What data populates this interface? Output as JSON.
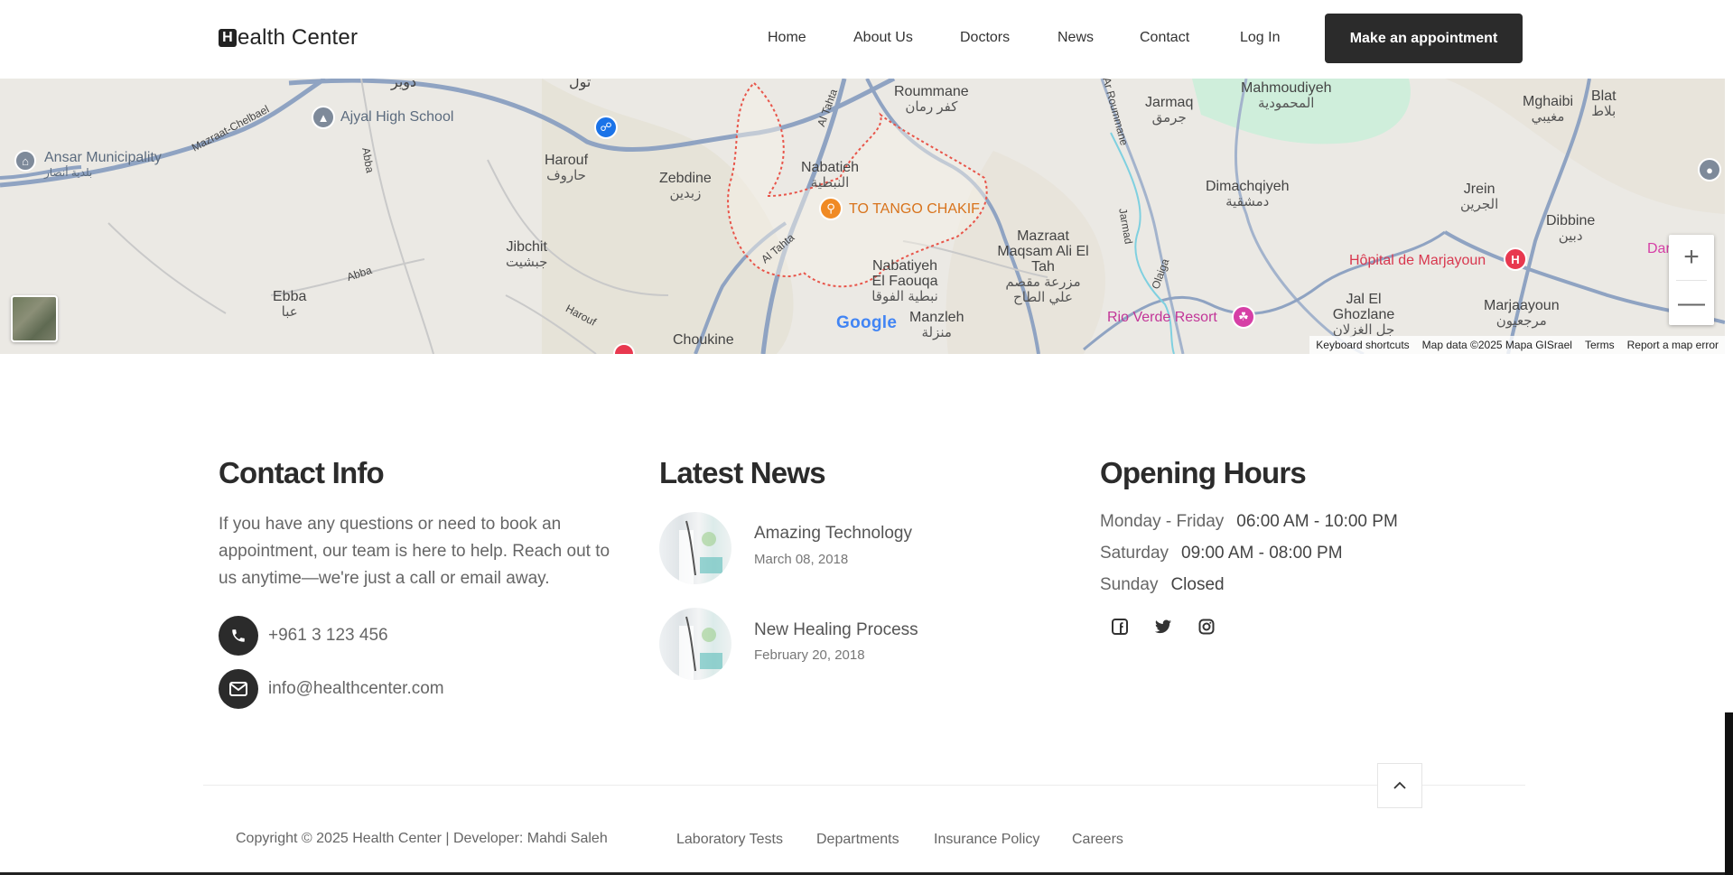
{
  "header": {
    "logo_letter": "H",
    "logo_text": "ealth Center",
    "nav": [
      "Home",
      "About Us",
      "Doctors",
      "News",
      "Contact",
      "Log In"
    ],
    "cta": "Make an appointment"
  },
  "map": {
    "places": [
      {
        "name": "Roummane",
        "ar": "كفر رمان"
      },
      {
        "name": "Mahmoudiyeh",
        "ar": "المحمودية"
      },
      {
        "name": "Jarmaq",
        "ar": "جرمق"
      },
      {
        "name": "Mghaibi",
        "ar": "مغيبي"
      },
      {
        "name": "Blat",
        "ar": "بلاط"
      },
      {
        "name": "Harouf",
        "ar": "حاروف"
      },
      {
        "name": "Zebdine",
        "ar": "زبدين"
      },
      {
        "name": "Nabatieh",
        "ar": "النبطية"
      },
      {
        "name": "Dimachqiyeh",
        "ar": "دمشقية"
      },
      {
        "name": "Jrein",
        "ar": "الجرين"
      },
      {
        "name": "Dibbine",
        "ar": "دبين"
      },
      {
        "name": "Jibchit",
        "ar": "جبشيت"
      },
      {
        "name": "Mazraat Maqsam Ali El Tah",
        "ar": "مزرعة مقصم علي الطاح"
      },
      {
        "name": "Nabatiyeh El Faouqa",
        "ar": "نبطية الفوقا"
      },
      {
        "name": "Ebba",
        "ar": "عبا"
      },
      {
        "name": "Manzleh",
        "ar": "منزلة"
      },
      {
        "name": "Jal El Ghozlane",
        "ar": "جل الغزلان"
      },
      {
        "name": "Marjaayoun",
        "ar": "مرجعيون"
      },
      {
        "name": "Choukine",
        "ar": ""
      }
    ],
    "pois": {
      "school": "Ajyal High School",
      "municipality": "Ansar Municipality",
      "municipality_ar": "بلدية أنصار",
      "restaurant": "TO TANGO CHAKIF",
      "hospital": "Hôpital de Marjayoun",
      "resort": "Rio Verde Resort",
      "edge": "Dar"
    },
    "roads": [
      "Mazraat-Chelbael",
      "Al Tahta",
      "Al Tahta",
      "Abba",
      "Abba",
      "Harouf",
      "Jarmad",
      "Olaiga",
      "Ar Roummane"
    ],
    "top_labels": [
      "دوير",
      "تول"
    ],
    "google": "Google",
    "footer": [
      "Keyboard shortcuts",
      "Map data ©2025 Mapa GISrael",
      "Terms",
      "Report a map error"
    ],
    "zoom_in": "+",
    "zoom_out": "—"
  },
  "contact": {
    "title": "Contact Info",
    "text": "If you have any questions or need to book an appointment, our team is here to help. Reach out to us anytime—we're just a call or email away.",
    "phone": "+961 3 123 456",
    "email": "info@healthcenter.com"
  },
  "news": {
    "title": "Latest News",
    "items": [
      {
        "title": "Amazing Technology",
        "date": "March 08, 2018"
      },
      {
        "title": "New Healing Process",
        "date": "February 20, 2018"
      }
    ]
  },
  "hours": {
    "title": "Opening Hours",
    "rows": [
      {
        "day": "Monday - Friday",
        "time": "06:00 AM - 10:00 PM"
      },
      {
        "day": "Saturday",
        "time": "09:00 AM - 08:00 PM"
      },
      {
        "day": "Sunday",
        "time": "Closed"
      }
    ],
    "social": [
      "facebook-icon",
      "twitter-icon",
      "instagram-icon"
    ]
  },
  "footer": {
    "copyright": "Copyright © 2025 Health Center | Developer: Mahdi Saleh",
    "links": [
      "Laboratory Tests",
      "Departments",
      "Insurance Policy",
      "Careers"
    ]
  },
  "colors": {
    "dark": "#2b2b2b",
    "map_bg": "#e9e7e2",
    "road": "#8fa3c2",
    "boundary": "#e8554a",
    "restaurant": "#f08a24",
    "hospital": "#e8384f",
    "resort": "#d63fa6",
    "school": "#7e8a9a",
    "park": "#cfeedb"
  }
}
